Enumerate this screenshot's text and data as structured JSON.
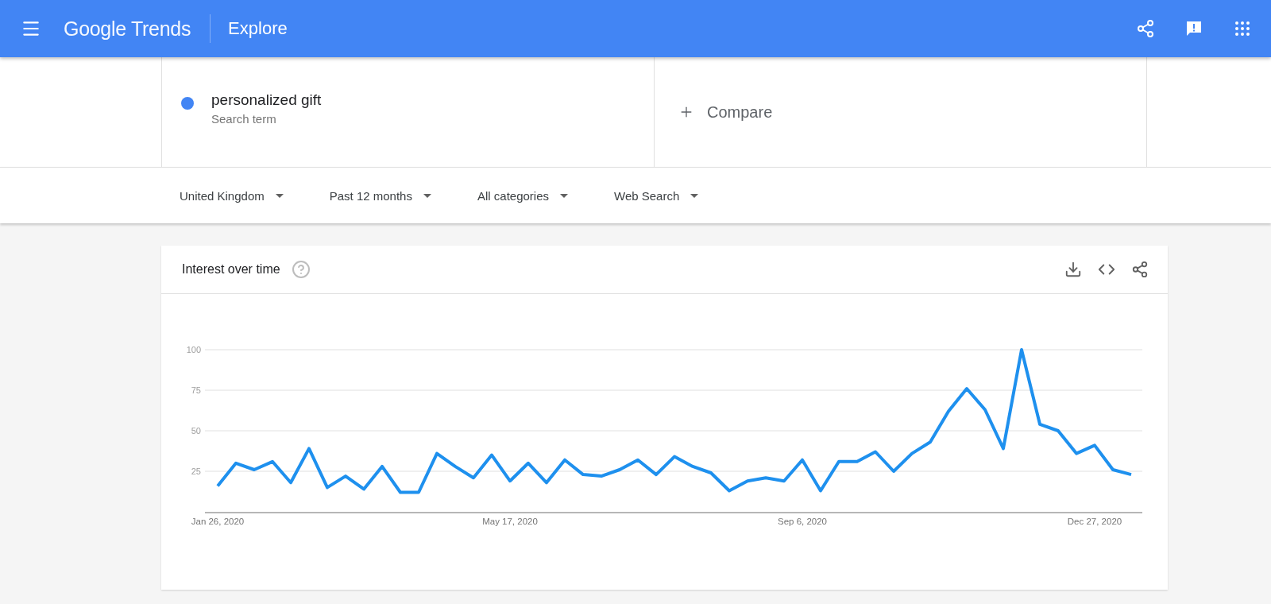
{
  "header": {
    "logo": "Google Trends",
    "title": "Explore"
  },
  "search_terms": [
    {
      "term": "personalized gift",
      "subtitle": "Search term",
      "color": "#4285f4"
    }
  ],
  "compare": {
    "label": "Compare"
  },
  "filters": [
    {
      "label": "United Kingdom"
    },
    {
      "label": "Past 12 months"
    },
    {
      "label": "All categories"
    },
    {
      "label": "Web Search"
    }
  ],
  "interest_card": {
    "title": "Interest over time",
    "chart_data": {
      "type": "line",
      "ylim": [
        0,
        100
      ],
      "yticks": [
        25,
        50,
        75,
        100
      ],
      "grid": true,
      "categories": [
        "Jan 26, 2020",
        null,
        null,
        null,
        null,
        null,
        null,
        null,
        null,
        null,
        null,
        null,
        null,
        null,
        null,
        null,
        "May 17, 2020",
        null,
        null,
        null,
        null,
        null,
        null,
        null,
        null,
        null,
        null,
        null,
        null,
        null,
        null,
        null,
        "Sep 6, 2020",
        null,
        null,
        null,
        null,
        null,
        null,
        null,
        null,
        null,
        null,
        null,
        null,
        null,
        null,
        null,
        "Dec 27, 2020",
        null,
        null
      ],
      "series": [
        {
          "color": "#1e90ee",
          "values": [
            16,
            30,
            26,
            31,
            18,
            39,
            15,
            22,
            14,
            28,
            12,
            12,
            36,
            28,
            21,
            35,
            19,
            30,
            18,
            32,
            23,
            22,
            26,
            32,
            23,
            34,
            28,
            24,
            13,
            19,
            21,
            19,
            32,
            13,
            31,
            31,
            37,
            25,
            36,
            43,
            62,
            76,
            63,
            39,
            100,
            54,
            50,
            36,
            41,
            26,
            23
          ]
        }
      ]
    }
  }
}
